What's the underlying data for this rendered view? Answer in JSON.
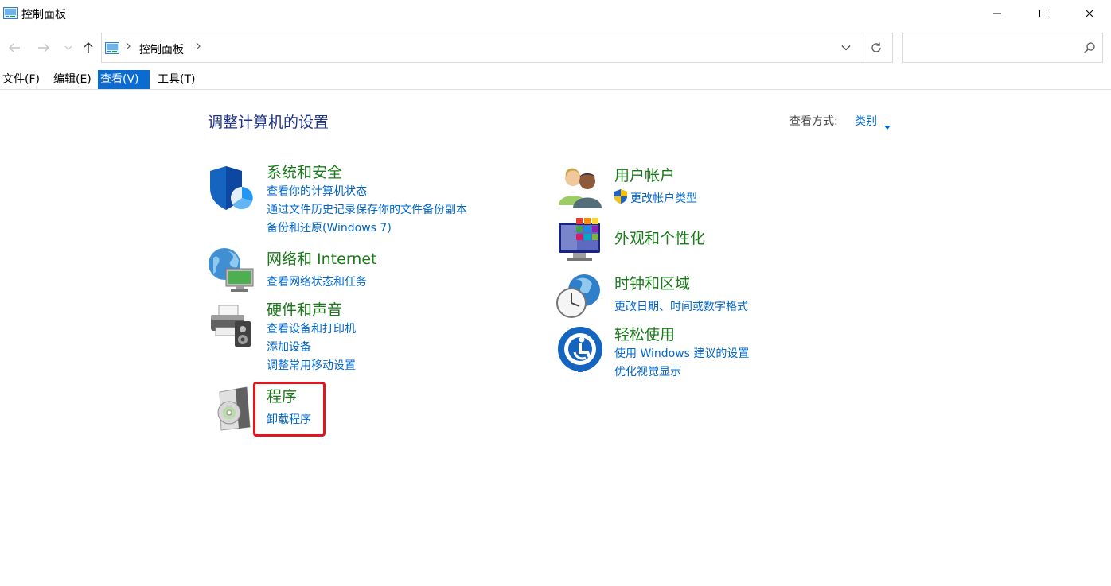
{
  "window": {
    "title": "控制面板"
  },
  "nav": {
    "breadcrumb": "控制面板",
    "search_placeholder": ""
  },
  "menu": {
    "items": [
      {
        "label": "文件(F)"
      },
      {
        "label": "编辑(E)"
      },
      {
        "label": "查看(V)"
      },
      {
        "label": "工具(T)"
      }
    ]
  },
  "main": {
    "title": "调整计算机的设置",
    "view_by_label": "查看方式:",
    "view_by_value": "类别"
  },
  "categories": {
    "left": [
      {
        "title": "系统和安全",
        "icon": "shield-icon",
        "links": [
          "查看你的计算机状态",
          "通过文件历史记录保存你的文件备份副本",
          "备份和还原(Windows 7)"
        ]
      },
      {
        "title": "网络和 Internet",
        "icon": "network-globe-icon",
        "links": [
          "查看网络状态和任务"
        ]
      },
      {
        "title": "硬件和声音",
        "icon": "printer-speaker-icon",
        "links": [
          "查看设备和打印机",
          "添加设备",
          "调整常用移动设置"
        ]
      },
      {
        "title": "程序",
        "icon": "programs-disc-icon",
        "links": [
          "卸载程序"
        ]
      }
    ],
    "right": [
      {
        "title": "用户帐户",
        "icon": "users-icon",
        "links": [
          "更改帐户类型"
        ]
      },
      {
        "title": "外观和个性化",
        "icon": "monitor-palette-icon",
        "links": []
      },
      {
        "title": "时钟和区域",
        "icon": "clock-globe-icon",
        "links": [
          "更改日期、时间或数字格式"
        ]
      },
      {
        "title": "轻松使用",
        "icon": "ease-of-access-icon",
        "links": [
          "使用 Windows 建议的设置",
          "优化视觉显示"
        ]
      }
    ]
  },
  "colors": {
    "category_title": "#1a7a1a",
    "link": "#0066cc",
    "page_title": "#1e3287",
    "menu_active": "#0b6bd0",
    "highlight": "#e4151c"
  }
}
